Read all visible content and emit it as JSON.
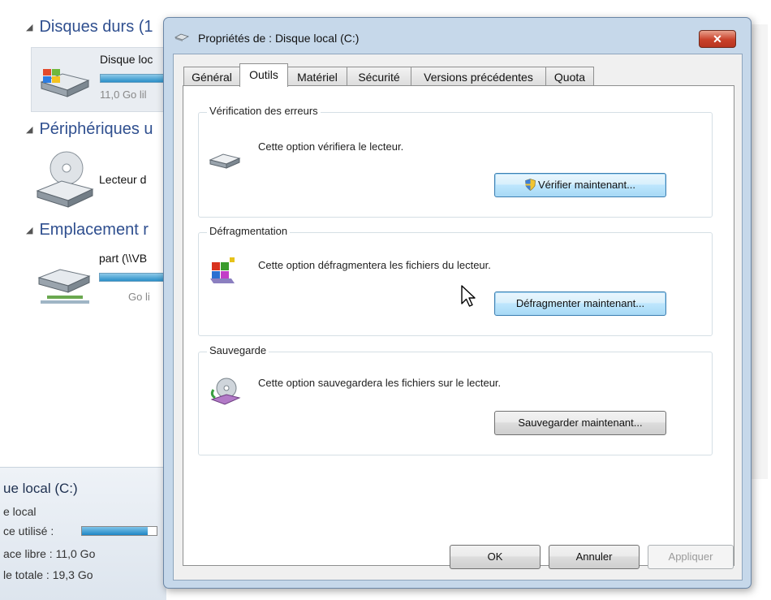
{
  "explorer": {
    "sections": [
      {
        "label": "Disques durs (1"
      },
      {
        "label": "Périphériques u"
      },
      {
        "label": "Emplacement r"
      }
    ],
    "hard_drive": {
      "name": "Disque loc",
      "sub": "11,0 Go lil"
    },
    "optical_drive": {
      "name": "Lecteur d"
    },
    "network_drive": {
      "name": "part (\\\\VB",
      "sub": "Go li"
    },
    "details": {
      "title": "ue local (C:)",
      "type": "e local",
      "used_label": "ce utilisé :",
      "used_fraction": 0.88,
      "free_label": "ace libre : 11,0 Go",
      "total_label": "le totale : 19,3 Go"
    }
  },
  "dialog": {
    "title": "Propriétés de : Disque local (C:)",
    "close_glyph": "✕",
    "tabs": [
      {
        "label": "Général"
      },
      {
        "label": "Outils"
      },
      {
        "label": "Matériel"
      },
      {
        "label": "Sécurité"
      },
      {
        "label": "Versions précédentes"
      },
      {
        "label": "Quota"
      }
    ],
    "active_tab": "Outils",
    "groups": {
      "check": {
        "label": "Vérification des erreurs",
        "desc": "Cette option vérifiera le lecteur.",
        "button": "Vérifier maintenant..."
      },
      "defrag": {
        "label": "Défragmentation",
        "desc": "Cette option défragmentera les fichiers du lecteur.",
        "button": "Défragmenter maintenant..."
      },
      "backup": {
        "label": "Sauvegarde",
        "desc": "Cette option sauvegardera les fichiers sur le lecteur.",
        "button": "Sauvegarder maintenant..."
      }
    },
    "footer": {
      "ok": "OK",
      "cancel": "Annuler",
      "apply": "Appliquer"
    }
  },
  "colors": {
    "dialog_frame": "#c6d8ea",
    "close_button": "#c9412a",
    "focus_button": "#bee6fd",
    "section_heading": "#2f4f8f"
  },
  "icons": [
    "drive-icon",
    "optical-drive-icon",
    "network-drive-icon",
    "shield-icon",
    "defrag-icon",
    "backup-icon",
    "close-icon",
    "mouse-cursor-icon"
  ]
}
